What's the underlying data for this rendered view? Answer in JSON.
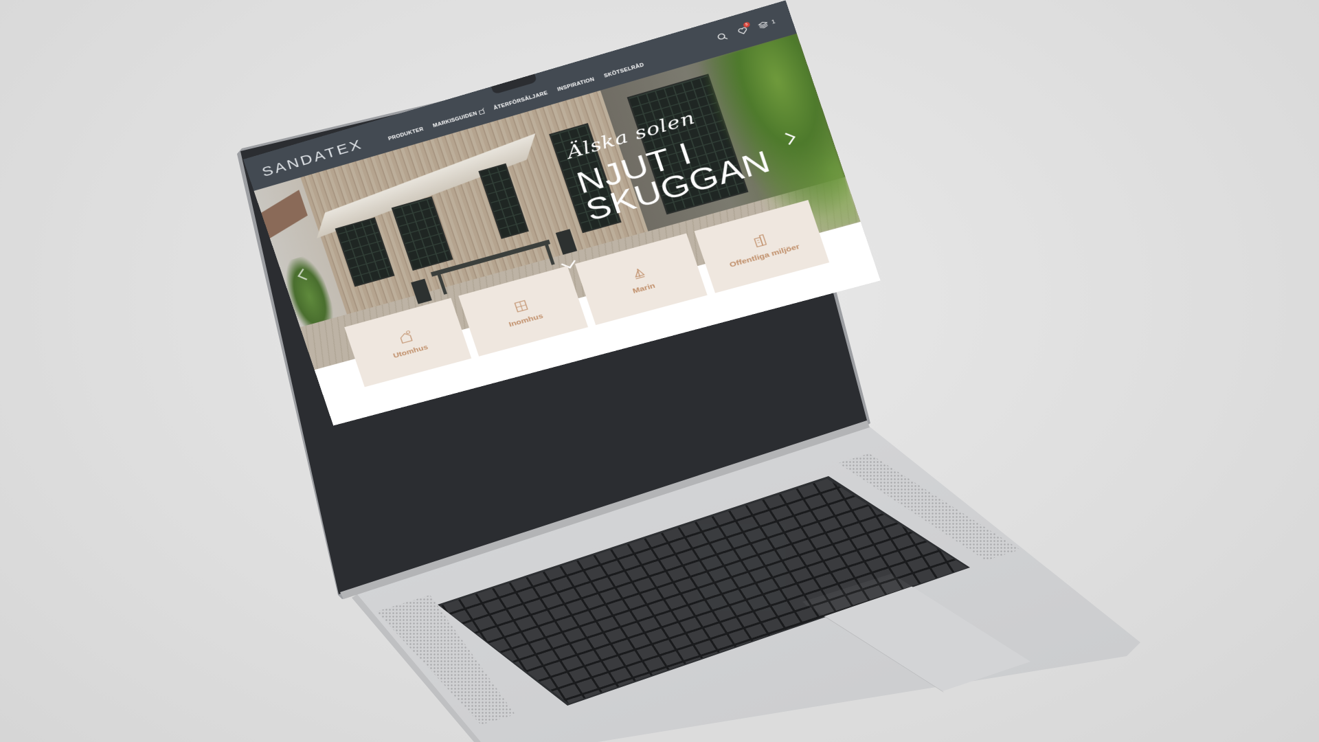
{
  "site": {
    "logo": "SANDATEX",
    "nav": [
      {
        "label": "PRODUKTER"
      },
      {
        "label": "MARKISGUIDEN"
      },
      {
        "label": "ÅTERFÖRSÄLJARE"
      },
      {
        "label": "INSPIRATION"
      },
      {
        "label": "SKÖTSELRÅD"
      }
    ],
    "header_icons": {
      "search": "search-icon",
      "wishlist": "heart-icon",
      "wishlist_badge": "5",
      "cart": "cart-icon",
      "cart_count": "1"
    }
  },
  "hero": {
    "script": "Älska solen",
    "title_line1": "NJUT I",
    "title_line2": "SKUGGAN"
  },
  "categories": [
    {
      "label": "Utomhus",
      "icon": "house-sun-icon"
    },
    {
      "label": "Inomhus",
      "icon": "window-icon"
    },
    {
      "label": "Marin",
      "icon": "sailboat-icon"
    },
    {
      "label": "Offentliga miljöer",
      "icon": "building-icon"
    }
  ],
  "colors": {
    "header_bg": "#434a52",
    "tile_bg": "#efe7df",
    "tile_text": "#c08f6a",
    "badge": "#d9443a"
  }
}
